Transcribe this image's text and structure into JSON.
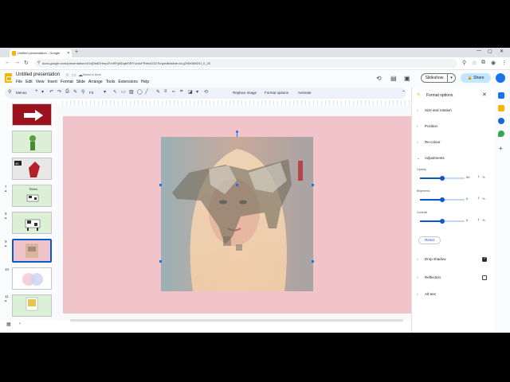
{
  "browser": {
    "tab_title": "Untitled presentation - Google",
    "new_tab": "+",
    "url": "docs.google.com/presentation/d/1xjDbdDHmpZVc9f7yBDqhf0Ef7ux4uFRbbcD1D7b/g/edit#slide=id.g2f3b0800f1f_0_25"
  },
  "app": {
    "title": "Untitled presentation",
    "saved_status": "Saved to Drive",
    "menu": [
      "File",
      "Edit",
      "View",
      "Insert",
      "Format",
      "Slide",
      "Arrange",
      "Tools",
      "Extensions",
      "Help"
    ],
    "slideshow_label": "Slideshow",
    "share_label": "Share"
  },
  "toolbar": {
    "search_menus": "Menus",
    "zoom": "Fit",
    "replace_image": "Replace image",
    "format_options": "Format options",
    "animate": "Animate"
  },
  "filmstrip": {
    "slides": [
      {
        "num": "",
        "kind": "red-arrow"
      },
      {
        "num": "",
        "kind": "character"
      },
      {
        "num": "",
        "kind": "hero-4k"
      },
      {
        "num": "7",
        "kind": "title-cow",
        "caption": "TiWes"
      },
      {
        "num": "8",
        "kind": "cow"
      },
      {
        "num": "9",
        "kind": "photo",
        "selected": true
      },
      {
        "num": "10",
        "kind": "circles"
      },
      {
        "num": "11",
        "kind": "polaroid"
      }
    ]
  },
  "format_panel": {
    "title": "Format options",
    "sections": {
      "size_rotation": "Size and rotation",
      "position": "Position",
      "recolour": "Re-colour",
      "adjustments": "Adjustments",
      "drop_shadow": "Drop shadow",
      "reflection": "Reflection",
      "alt_text": "Alt text"
    },
    "adjustments": {
      "opacity_label": "Opacity",
      "opacity_value": "50",
      "brightness_label": "Brightness",
      "brightness_value": "0",
      "contrast_label": "Contrast",
      "contrast_value": "0",
      "unit": "%"
    },
    "reset_label": "Reset",
    "drop_shadow_checked": true,
    "reflection_checked": false
  }
}
